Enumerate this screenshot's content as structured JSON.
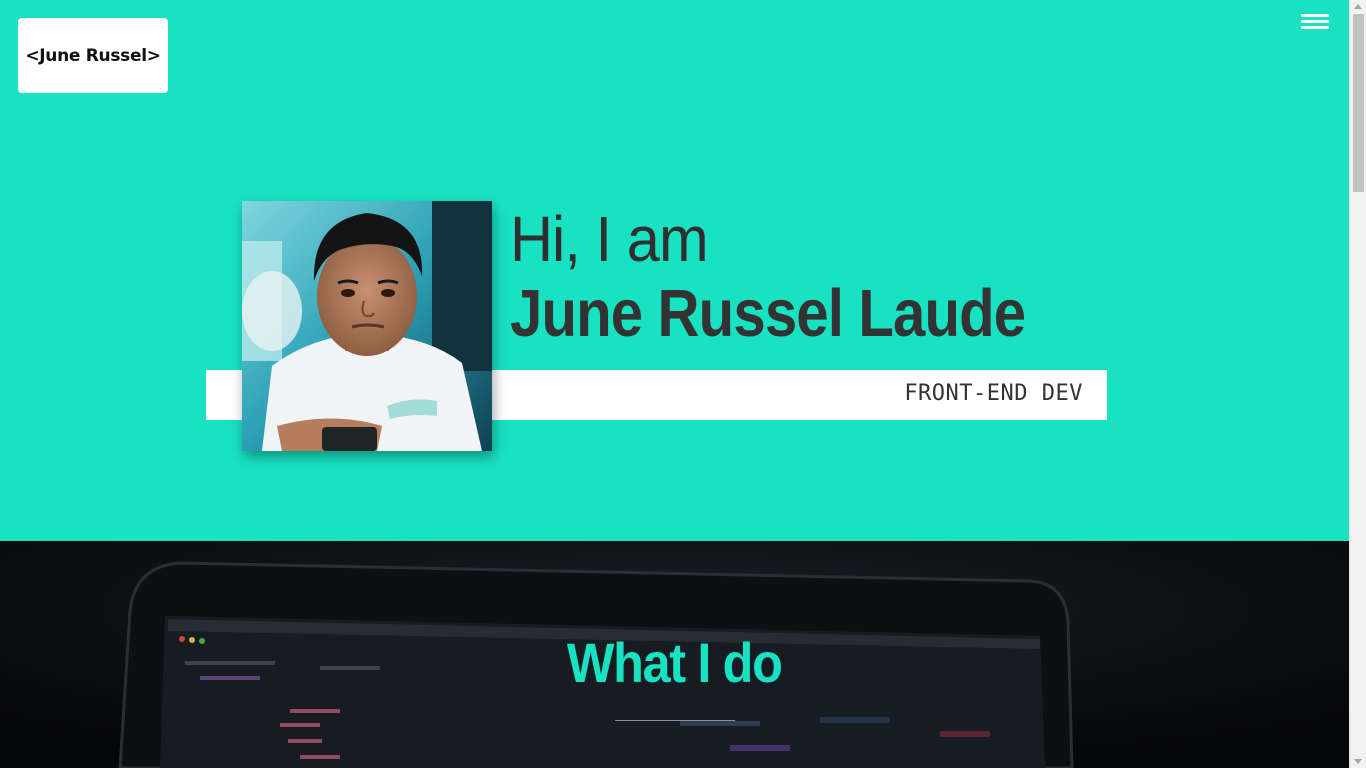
{
  "header": {
    "logo_text": "<June Russel>",
    "menu_icon": "hamburger-menu-icon"
  },
  "hero": {
    "greeting": "Hi, I am",
    "name": "June Russel Laude",
    "role": "FRONT-END DEV",
    "avatar_icon": "profile-photo"
  },
  "what_i_do": {
    "title": "What I do",
    "background_icon": "laptop-code-editor-photo"
  },
  "colors": {
    "accent": "#19e2c2",
    "text_dark": "#333333",
    "section_dark": "#050607"
  }
}
